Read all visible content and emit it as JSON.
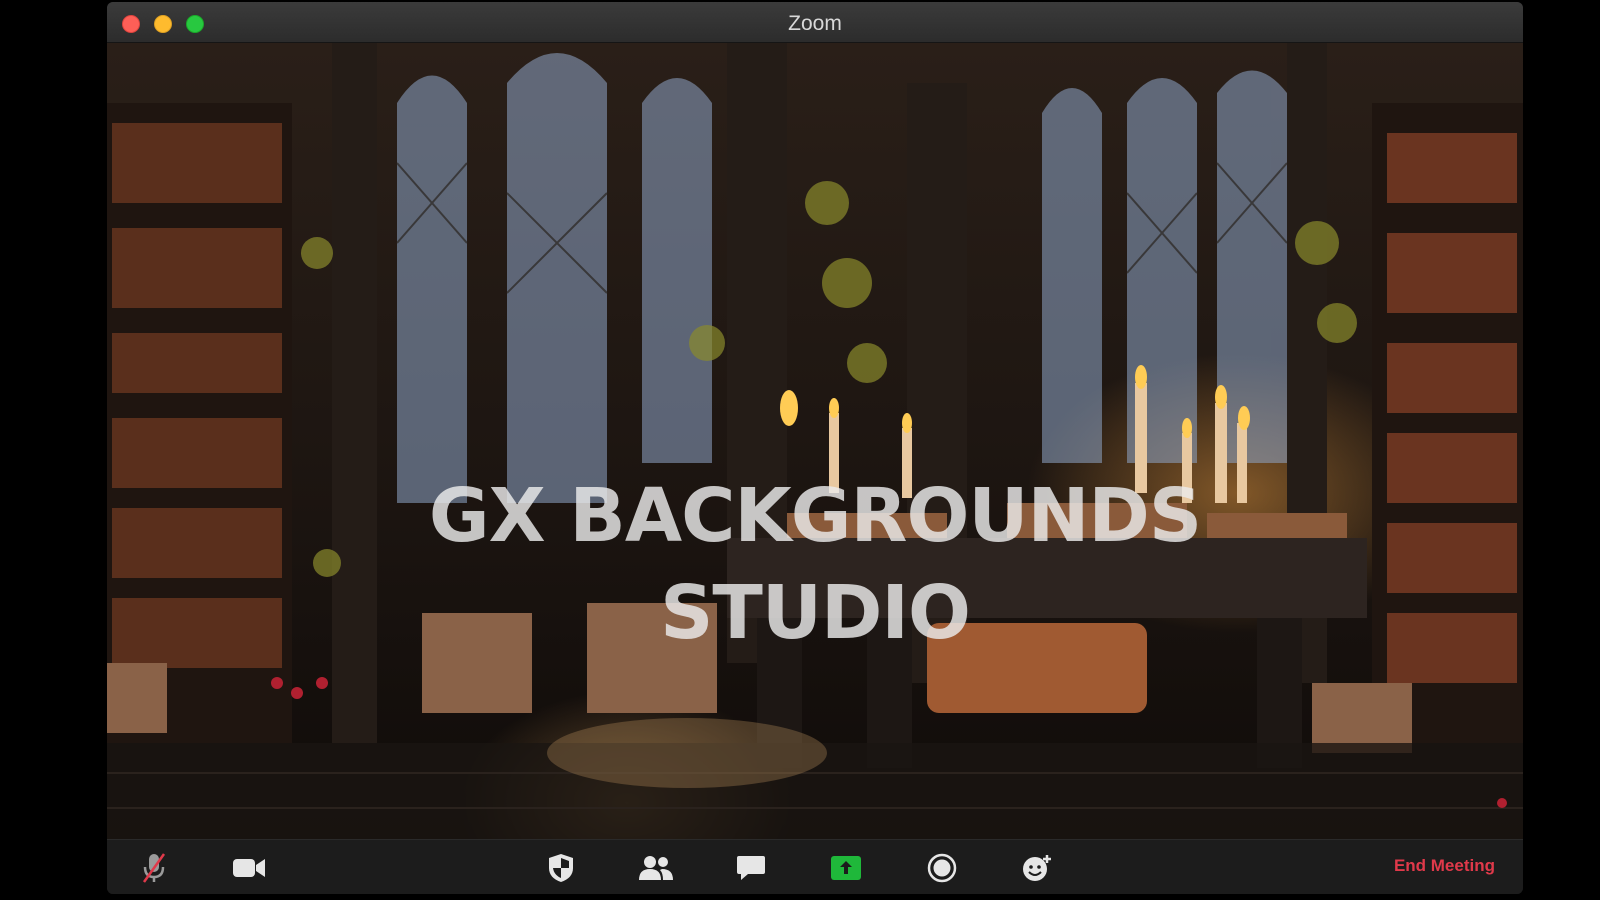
{
  "window": {
    "title": "Zoom"
  },
  "video": {
    "watermark_line1": "GX BACKGROUNDS",
    "watermark_line2": "STUDIO"
  },
  "toolbar": {
    "buttons": [
      {
        "name": "mute",
        "icon": "microphone-muted-icon"
      },
      {
        "name": "video",
        "icon": "video-camera-icon"
      },
      {
        "name": "security",
        "icon": "shield-icon"
      },
      {
        "name": "participants",
        "icon": "participants-icon"
      },
      {
        "name": "chat",
        "icon": "chat-bubble-icon"
      },
      {
        "name": "share-screen",
        "icon": "share-screen-icon"
      },
      {
        "name": "record",
        "icon": "record-icon"
      },
      {
        "name": "reactions",
        "icon": "reaction-emoji-icon"
      }
    ],
    "end_meeting_label": "End Meeting"
  },
  "colors": {
    "end_meeting": "#e0394a",
    "share_green": "#1fb83a",
    "toolbar_bg": "#1c1c1c"
  }
}
